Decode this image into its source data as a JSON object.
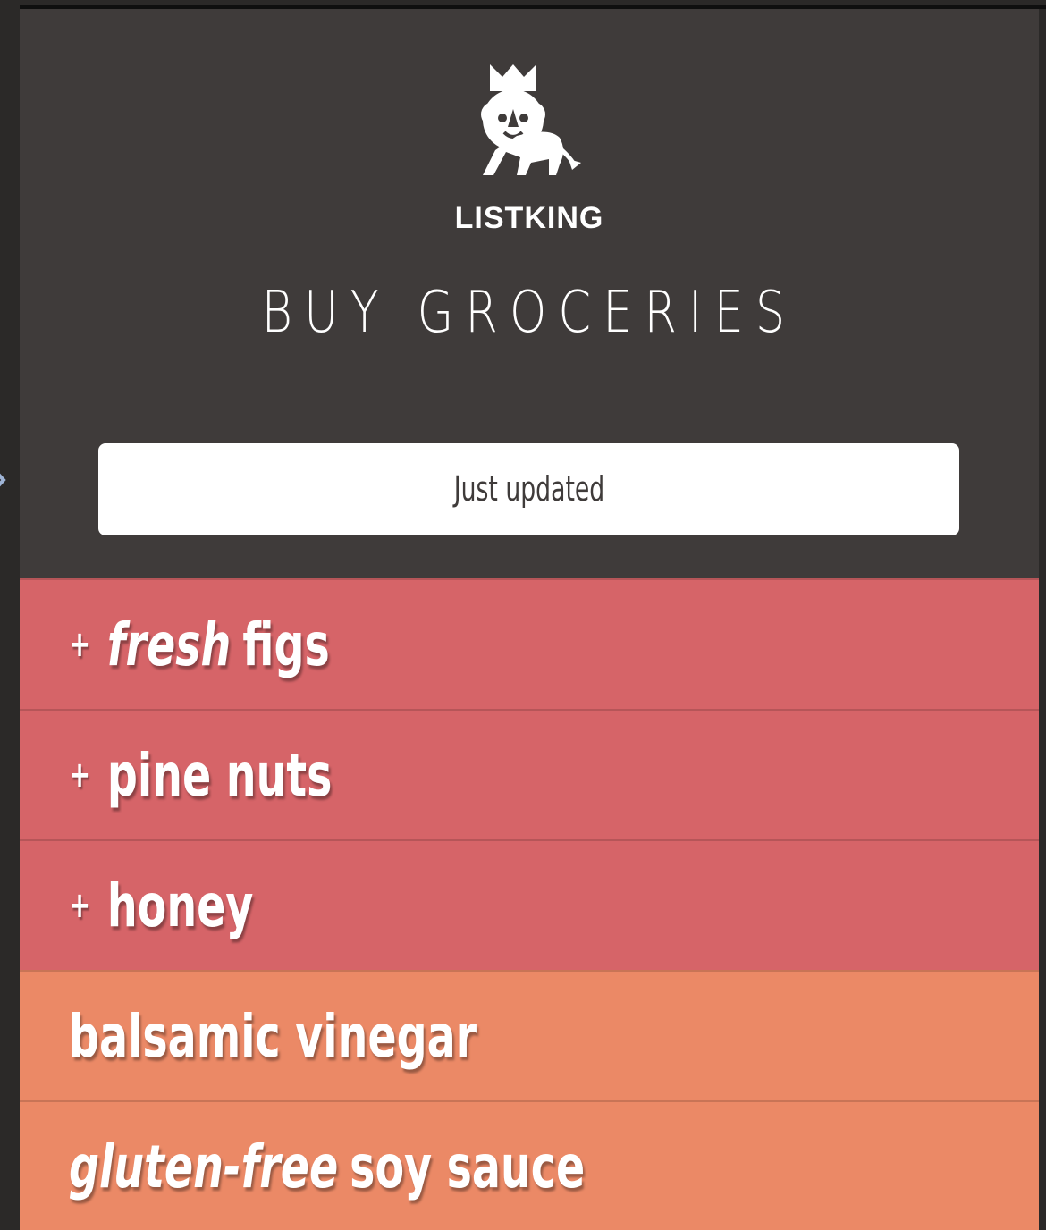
{
  "app": {
    "brand": "LISTKING",
    "list_title": "BUY GROCERIES",
    "status": "Just updated"
  },
  "colors": {
    "header_bg": "#3f3b3a",
    "priority_item": "#d66468",
    "regular_item": "#eb8966",
    "text": "#ffffff"
  },
  "items": [
    {
      "prefix": "+",
      "emphasis": "fresh",
      "text": "figs",
      "priority": true
    },
    {
      "prefix": "+",
      "emphasis": "",
      "text": "pine nuts",
      "priority": true
    },
    {
      "prefix": "+",
      "emphasis": "",
      "text": "honey",
      "priority": true
    },
    {
      "prefix": "",
      "emphasis": "",
      "text": "balsamic vinegar",
      "priority": false
    },
    {
      "prefix": "",
      "emphasis": "gluten-free",
      "text": "soy sauce",
      "priority": false
    }
  ]
}
